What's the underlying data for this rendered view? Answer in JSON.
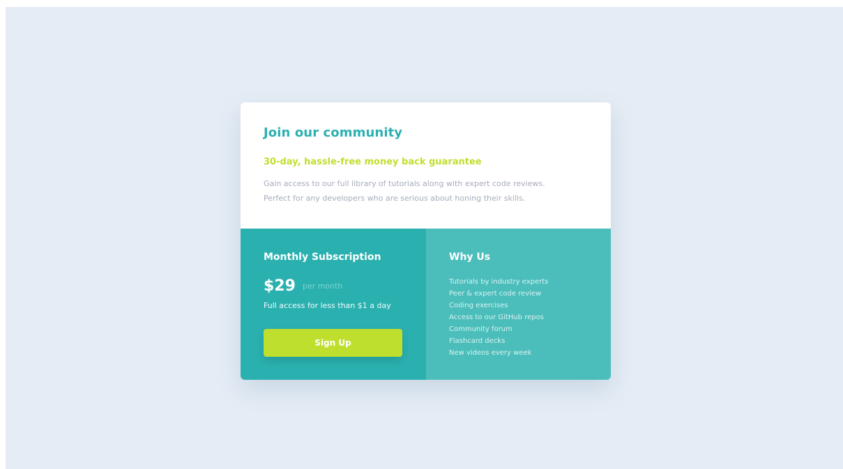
{
  "card": {
    "title": "Join our community",
    "guarantee": "30-day, hassle-free money back guarantee",
    "description_lines": [
      "Gain access to our full library of tutorials along with expert code reviews.",
      "Perfect for any developers who are serious about honing their skills."
    ]
  },
  "subscription": {
    "title": "Monthly Subscription",
    "price": "$29",
    "period": "per month",
    "note": "Full access for less than $1 a day",
    "button_label": "Sign Up"
  },
  "why_us": {
    "title": "Why Us",
    "features": [
      "Tutorials by industry experts",
      "Peer & expert code review",
      "Coding exercises",
      "Access to our GitHub repos",
      "Community forum",
      "Flashcard decks",
      "New videos every week"
    ]
  },
  "colors": {
    "page_background": "#e5ecf5",
    "card_background": "#ffffff",
    "primary_teal": "#2bb0b0",
    "secondary_teal": "#4bbebb",
    "accent_lime": "#bfdf2f",
    "muted_text": "#a6acbc"
  }
}
